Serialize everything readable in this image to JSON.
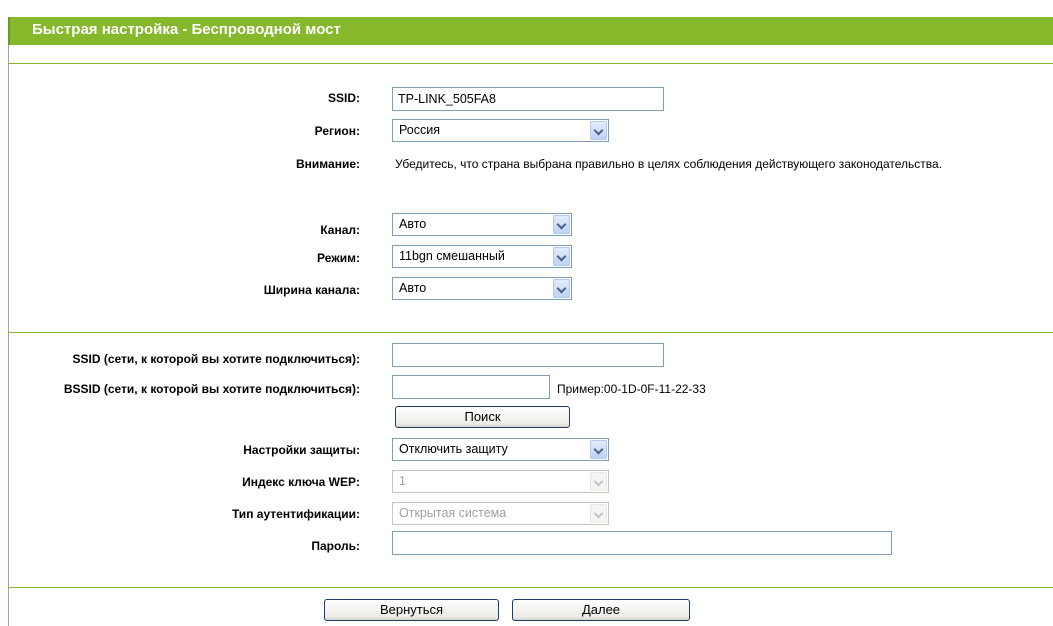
{
  "page": {
    "title": "Быстрая настройка - Беспроводной мост"
  },
  "section1": {
    "ssid_label": "SSID:",
    "ssid_value": "TP-LINK_505FA8",
    "region_label": "Регион:",
    "region_value": "Россия",
    "warning_label": "Внимание:",
    "warning_text": "Убедитесь, что страна выбрана правильно в целях соблюдения действующего законодательства.",
    "channel_label": "Канал:",
    "channel_value": "Авто",
    "mode_label": "Режим:",
    "mode_value": "11bgn смешанный",
    "width_label": "Ширина канала:",
    "width_value": "Авто"
  },
  "section2": {
    "remote_ssid_label": "SSID (сети, к которой вы хотите подключиться):",
    "remote_ssid_value": "",
    "remote_bssid_label": "BSSID (сети, к которой вы хотите подключиться):",
    "remote_bssid_value": "",
    "bssid_example": "Пример:00-1D-0F-11-22-33",
    "search_button": "Поиск",
    "security_label": "Настройки защиты:",
    "security_value": "Отключить защиту",
    "wep_index_label": "Индекс ключа WEP:",
    "wep_index_value": "1",
    "auth_type_label": "Тип аутентификации:",
    "auth_type_value": "Открытая система",
    "password_label": "Пароль:",
    "password_value": ""
  },
  "footer": {
    "back_button": "Вернуться",
    "next_button": "Далее"
  },
  "colors": {
    "title_bar": "#86b82c",
    "divider": "#86b82c"
  },
  "icons": {
    "select_arrow": "chevron-down-icon"
  }
}
